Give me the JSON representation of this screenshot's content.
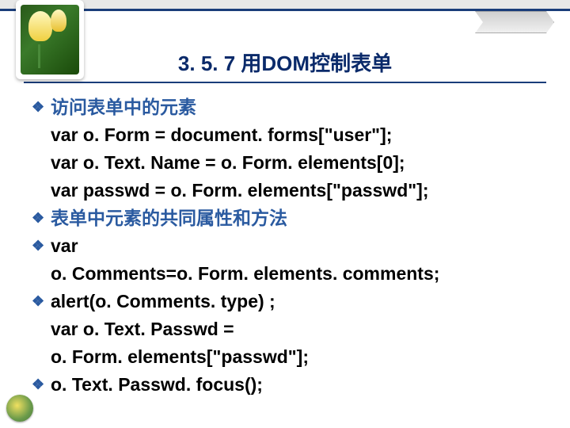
{
  "title": "3. 5. 7 用DOM控制表单",
  "bullets": {
    "b1": "访问表单中的元素",
    "l1": "var o. Form = document. forms[\"user\"];",
    "l2": "var o. Text. Name = o. Form. elements[0];",
    "l3": "var passwd = o. Form. elements[\"passwd\"];",
    "b2": "表单中元素的共同属性和方法",
    "b3": "var",
    "l4": "o. Comments=o. Form. elements. comments;",
    "b4": "alert(o. Comments. type) ;",
    "l5": "var o. Text. Passwd =",
    "l6": "o. Form. elements[\"passwd\"];",
    "b5": "o. Text. Passwd. focus();"
  }
}
